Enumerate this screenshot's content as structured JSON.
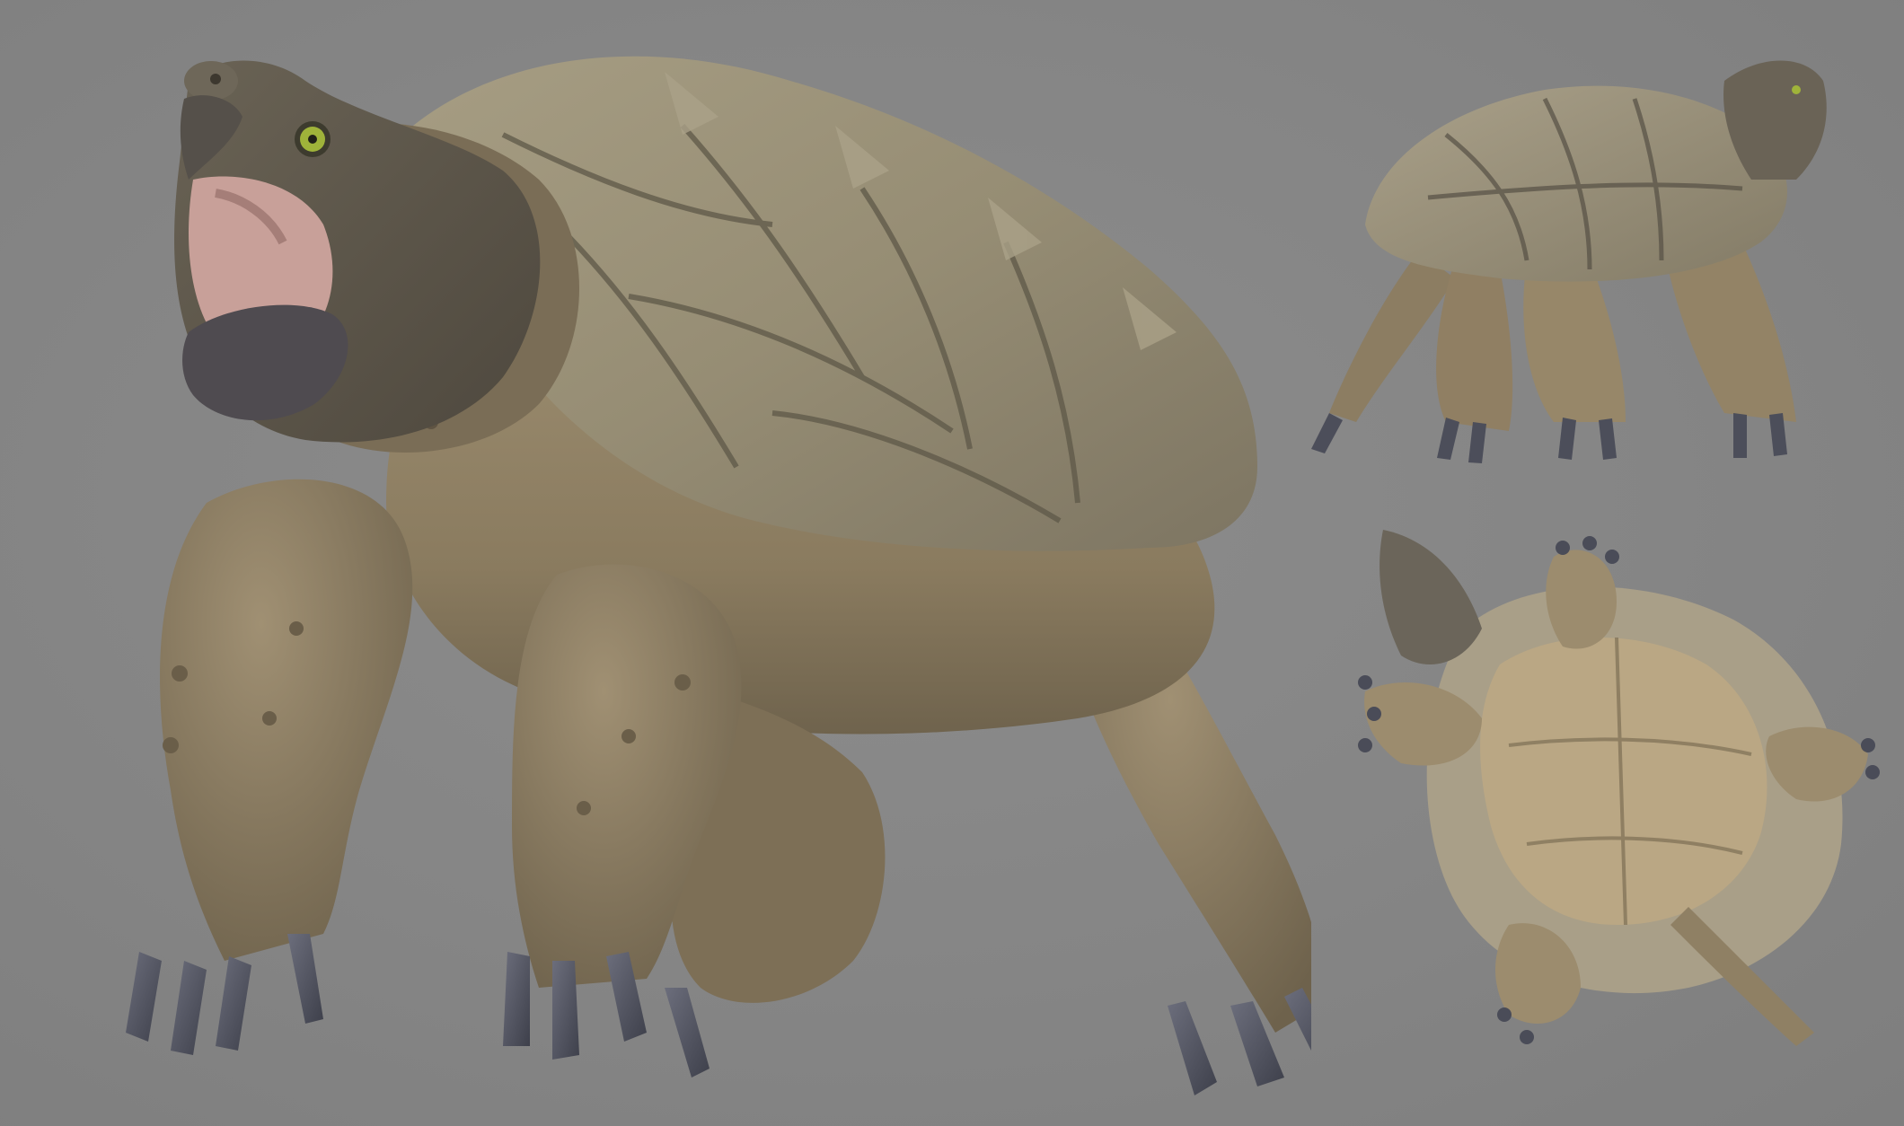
{
  "scene": {
    "subject": "snapping-turtle-sculpt",
    "views": [
      "main-three-quarter-view",
      "top-side-view",
      "underside-view"
    ],
    "colors": {
      "background": "#858585",
      "skin_light": "#a8987a",
      "skin_mid": "#8f7f62",
      "skin_dark": "#6b5f4a",
      "head": "#5d564a",
      "shell": "#9b9278",
      "shell_dark": "#6e6757",
      "claw": "#4a4c58",
      "mouth": "#d9a9a0",
      "eye": "#9fb33a",
      "plastron": "#b9a683"
    }
  }
}
